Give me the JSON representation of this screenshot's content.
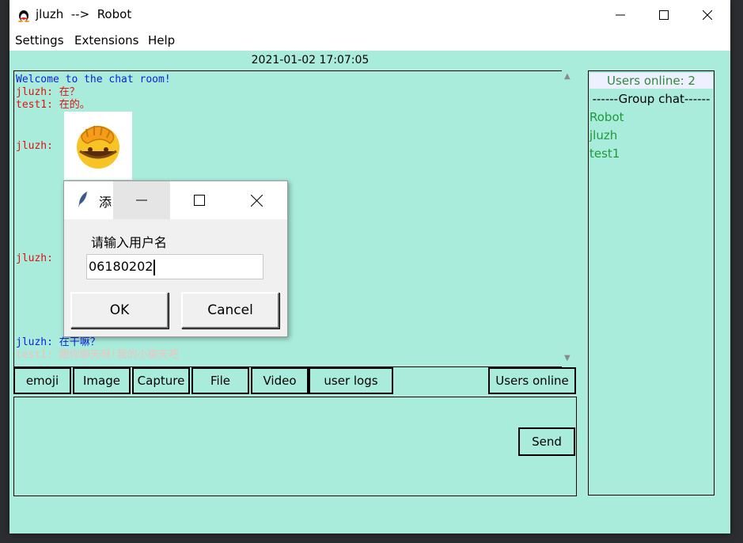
{
  "window": {
    "title": "jluzh  -->  Robot",
    "minimize_icon": "minimize-icon",
    "maximize_icon": "maximize-icon",
    "close_icon": "close-icon"
  },
  "menubar": {
    "items": [
      "Settings",
      "Extensions",
      "Help"
    ]
  },
  "timestamp": "2021-01-02 17:07:05",
  "chat": {
    "welcome": "Welcome to the chat room!",
    "messages": [
      {
        "sender": "jluzh:",
        "text": "在？",
        "color": "#e01010"
      },
      {
        "sender": "test1:",
        "text": "在的。",
        "color": "#e01010"
      },
      {
        "sender": "jluzh:",
        "text": "",
        "color": "#e01010"
      },
      {
        "sender": "jluzh:",
        "text": "",
        "color": "#e01010"
      },
      {
        "sender": "jluzh:",
        "text": "在干嘛？",
        "color": "#0b1ee0"
      },
      {
        "sender": "test1:",
        "text": "跟你聊天呀!我的小聊天吧",
        "color": "#f2c0c0"
      }
    ]
  },
  "toolbar": {
    "emoji": "emoji",
    "image": "Image",
    "capture": "Capture",
    "file": "File",
    "video": "Video",
    "user_logs": "user logs",
    "users_online": "Users online"
  },
  "send_label": "Send",
  "users_panel": {
    "header": "Users online: 2",
    "group_chat": "------Group chat------",
    "users": [
      "Robot",
      "jluzh",
      "test1"
    ]
  },
  "dialog": {
    "title": "添",
    "label": "请输入用户名",
    "value": "06180202",
    "ok": "OK",
    "cancel": "Cancel"
  },
  "colors": {
    "background": "#aaecdc",
    "welcome": "#0b1ee0",
    "user_green": "#1f9a3a"
  }
}
